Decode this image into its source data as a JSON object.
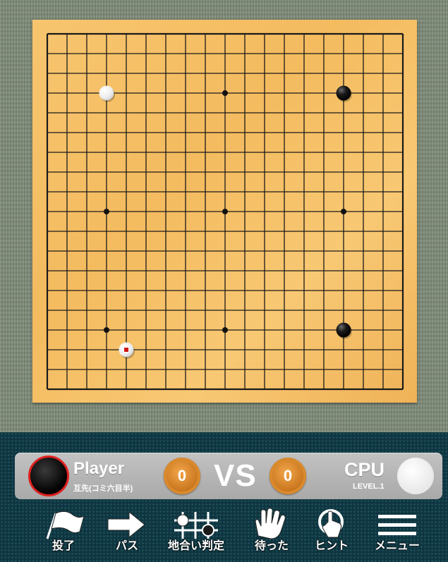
{
  "board": {
    "size": 19,
    "star_points": [
      [
        3,
        3
      ],
      [
        9,
        3
      ],
      [
        15,
        3
      ],
      [
        3,
        9
      ],
      [
        9,
        9
      ],
      [
        15,
        9
      ],
      [
        3,
        15
      ],
      [
        9,
        15
      ],
      [
        15,
        15
      ]
    ],
    "stones": [
      {
        "color": "white",
        "col": 3,
        "row": 3
      },
      {
        "color": "black",
        "col": 15,
        "row": 3
      },
      {
        "color": "black",
        "col": 15,
        "row": 15
      },
      {
        "color": "white",
        "col": 4,
        "row": 16,
        "last_move": true
      }
    ]
  },
  "scorebar": {
    "player": {
      "name": "Player",
      "sub": "互先(コミ六目半)",
      "captures": "0",
      "stone": "black"
    },
    "vs": "VS",
    "cpu": {
      "name": "CPU",
      "sub": "LEVEL.1",
      "captures": "0",
      "stone": "white"
    }
  },
  "toolbar": {
    "resign": "投了",
    "pass": "パス",
    "territory": "地合い判定",
    "undo": "待った",
    "hint": "ヒント",
    "menu": "メニュー"
  },
  "colors": {
    "board": "#f4bb5f",
    "last_move_marker": "#d01818",
    "player_ring": "#e02020",
    "panel": "#0f3540"
  }
}
